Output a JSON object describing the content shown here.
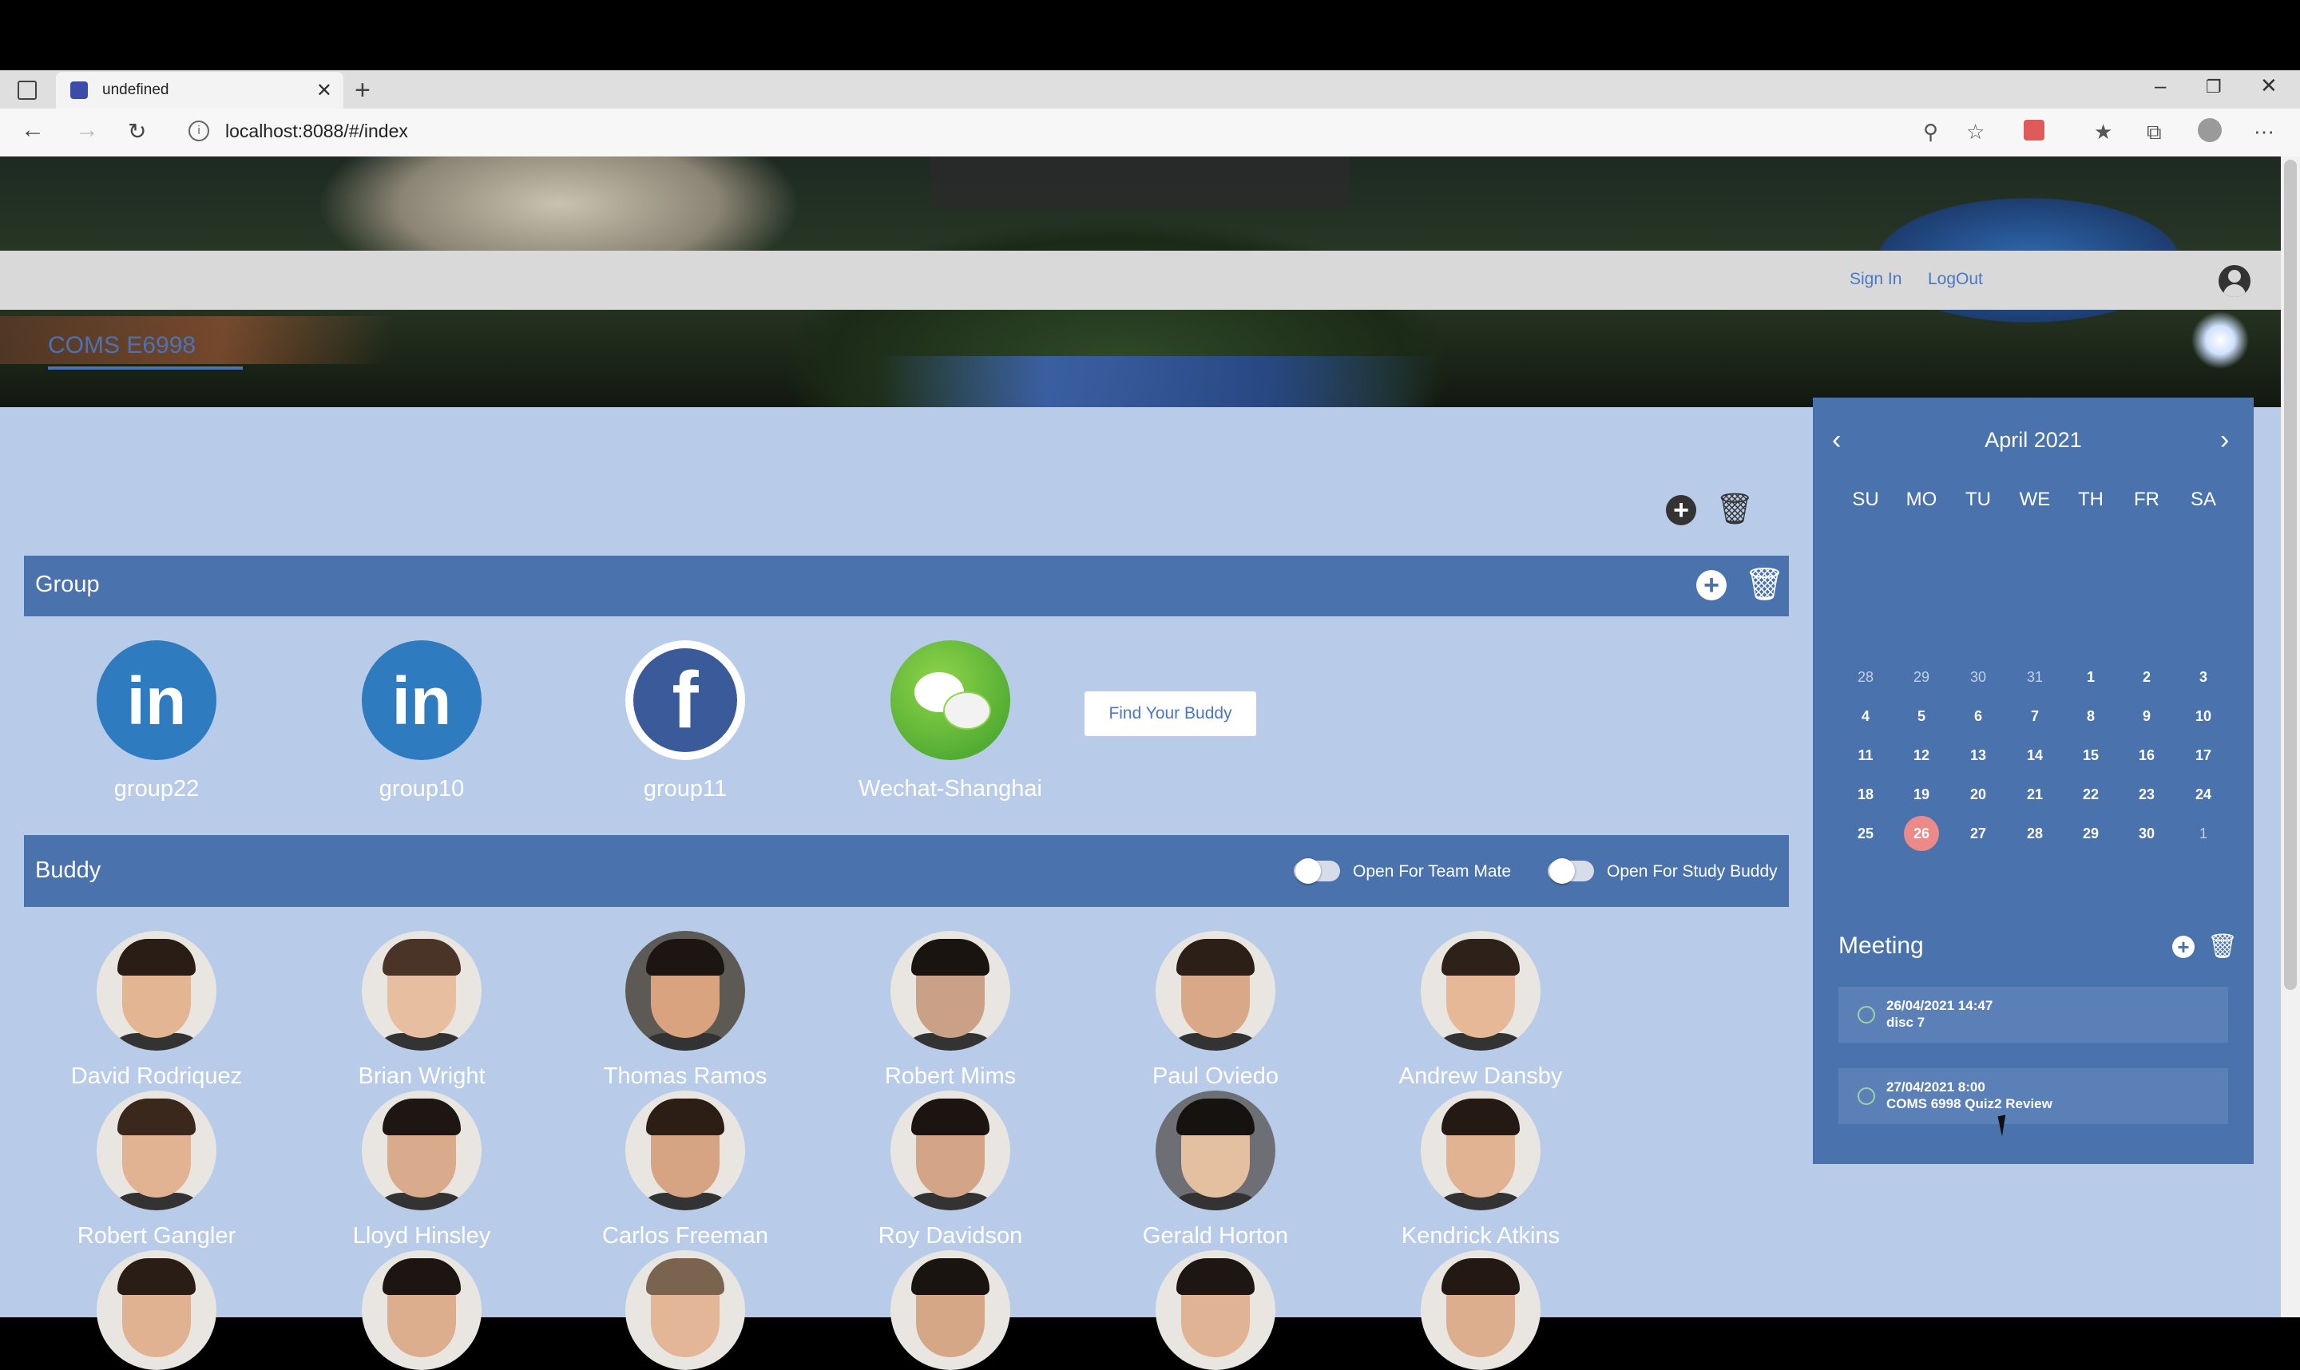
{
  "browser": {
    "tab_title": "undefined",
    "url": "localhost:8088/#/index",
    "new_tab_label": "+",
    "close_tab": "✕"
  },
  "header": {
    "sign_in": "Sign In",
    "logout": "LogOut"
  },
  "course": {
    "tab_label": "COMS E6998"
  },
  "group_panel": {
    "title": "Group",
    "groups": [
      {
        "name": "group22",
        "icon": "linkedin-icon"
      },
      {
        "name": "group10",
        "icon": "linkedin-icon"
      },
      {
        "name": "group11",
        "icon": "facebook-icon"
      },
      {
        "name": "Wechat-Shanghai",
        "icon": "wechat-icon"
      }
    ]
  },
  "buddy_panel": {
    "title": "Buddy",
    "find_button": "Find Your Buddy",
    "toggle_team": "Open For Team Mate",
    "toggle_study": "Open For Study Buddy",
    "buddies": [
      "David Rodriquez",
      "Brian Wright",
      "Thomas Ramos",
      "Robert Mims",
      "Paul Oviedo",
      "Andrew Dansby",
      "Robert Gangler",
      "Lloyd Hinsley",
      "Carlos Freeman",
      "Roy Davidson",
      "Gerald Horton",
      "Kendrick Atkins"
    ]
  },
  "calendar": {
    "month_label": "April",
    "year_label": "2021",
    "weekdays": [
      "SU",
      "MO",
      "TU",
      "WE",
      "TH",
      "FR",
      "SA"
    ],
    "weeks": [
      [
        "28",
        "29",
        "30",
        "31",
        "1",
        "2",
        "3"
      ],
      [
        "4",
        "5",
        "6",
        "7",
        "8",
        "9",
        "10"
      ],
      [
        "11",
        "12",
        "13",
        "14",
        "15",
        "16",
        "17"
      ],
      [
        "18",
        "19",
        "20",
        "21",
        "22",
        "23",
        "24"
      ],
      [
        "25",
        "26",
        "27",
        "28",
        "29",
        "30",
        "1"
      ]
    ],
    "today": "26"
  },
  "meetings": {
    "title": "Meeting",
    "items": [
      {
        "date": "26/04/2021 14:47",
        "text": "disc 7"
      },
      {
        "date": "27/04/2021 8:00",
        "text": "COMS 6998 Quiz2 Review"
      }
    ]
  },
  "colors": {
    "page_bg": "#b8cbe9",
    "panel_bar": "#4a73ad",
    "link": "#4a78c6",
    "today": "#ec8a8a"
  }
}
